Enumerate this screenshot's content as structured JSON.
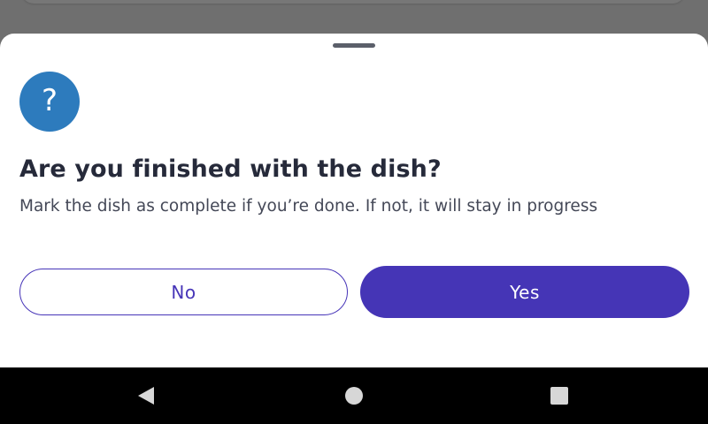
{
  "dialog": {
    "icon": "question-mark-icon",
    "icon_glyph": "?",
    "title": "Are you finished with the dish?",
    "message": "Mark the dish as complete if you’re done. If not, it will stay in progress",
    "no_label": "No",
    "yes_label": "Yes"
  },
  "colors": {
    "icon_background": "#2d7bbd",
    "primary": "#4535b6",
    "title_text": "#262a3a",
    "scrim": "#6f6f6f",
    "nav_bar": "#000000"
  },
  "system_nav": {
    "back_icon": "back-triangle-icon",
    "home_icon": "home-circle-icon",
    "recents_icon": "recents-square-icon"
  }
}
